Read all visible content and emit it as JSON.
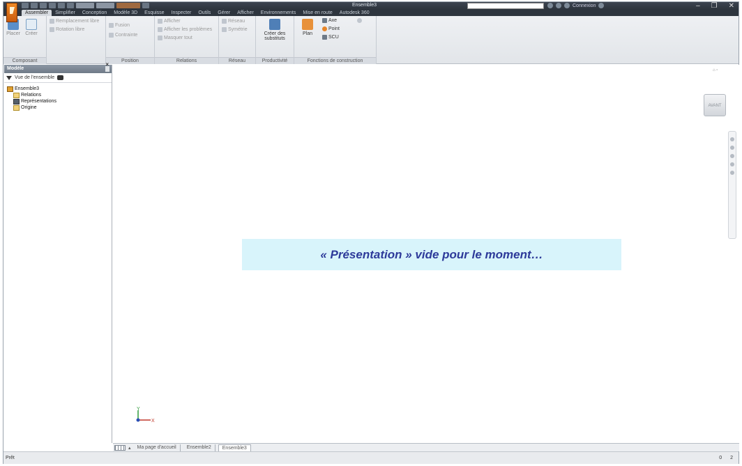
{
  "window": {
    "title": "Ensemble3",
    "search_placeholder": "",
    "connect_label": "Connexion"
  },
  "ribbon": {
    "tabs": [
      "Assembler",
      "Simplifier",
      "Conception",
      "Modèle 3D",
      "Esquisse",
      "Inspecter",
      "Outils",
      "Gérer",
      "Afficher",
      "Environnements",
      "Mise en route",
      "Autodesk 360"
    ],
    "active_tab": "Assembler",
    "panels": {
      "composant": {
        "title": "Composant",
        "place": "Placer",
        "create": "Créer",
        "items": [
          "Remplacement libre",
          "Rotation libre"
        ]
      },
      "position": {
        "title": "Position",
        "items": [
          "Fusion",
          "Contrainte"
        ]
      },
      "relations": {
        "title": "Relations",
        "items": [
          "Afficher",
          "Afficher les problèmes",
          "Masquer tout"
        ]
      },
      "reseau": {
        "title": "Réseau",
        "items": [
          "Réseau",
          "Symétrie"
        ]
      },
      "productivite": {
        "title": "Productivité",
        "create_substitute": "Créer des substituts"
      },
      "fonctions": {
        "title": "Fonctions de construction",
        "plan": "Plan",
        "axe": "Axe",
        "point": "Point",
        "ucs": "SCU"
      }
    }
  },
  "browser": {
    "title": "Modèle",
    "view_label": "Vue de l'ensemble",
    "tree": {
      "root": "Ensemble3",
      "children": [
        "Relations",
        "Représentations",
        "Origine"
      ]
    }
  },
  "canvas": {
    "message": "« Présentation » vide pour le moment…",
    "viewcube_label": "AVANT",
    "axis_x": "X",
    "axis_y": "Y"
  },
  "doctabs": {
    "items": [
      "Ma page d'accueil",
      "Ensemble2",
      "Ensemble3"
    ],
    "active": "Ensemble3"
  },
  "status": {
    "text": "Prêt",
    "right_values": [
      "0",
      "2"
    ]
  }
}
